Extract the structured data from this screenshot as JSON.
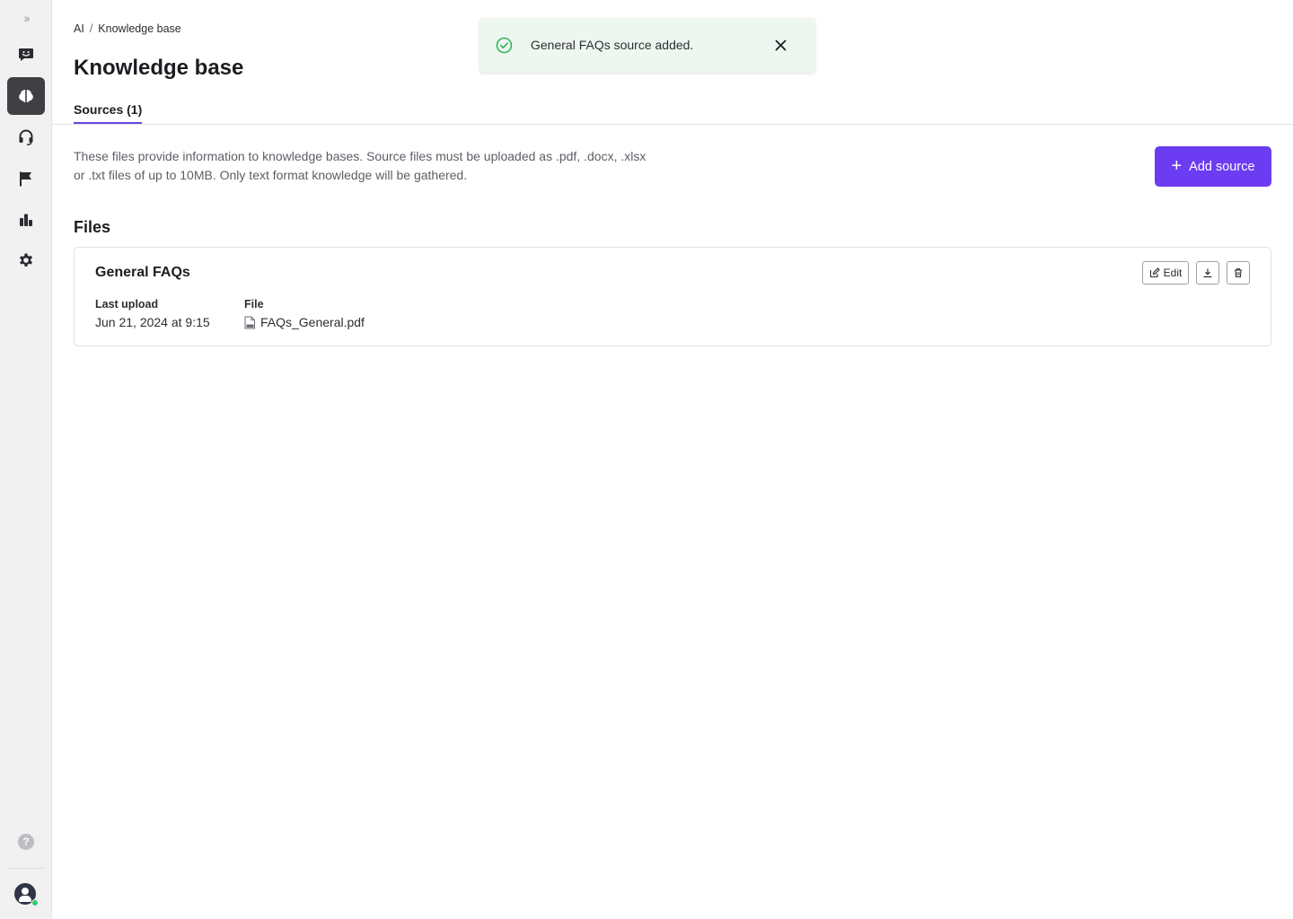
{
  "sidebar": {
    "expand_icon": "double-chevron-right-icon",
    "items": [
      {
        "name": "conversations",
        "icon": "chat-smile-icon",
        "active": false
      },
      {
        "name": "ai",
        "icon": "brain-icon",
        "active": true
      },
      {
        "name": "support",
        "icon": "headset-icon",
        "active": false
      },
      {
        "name": "flags",
        "icon": "flag-icon",
        "active": false
      },
      {
        "name": "reports",
        "icon": "bar-chart-icon",
        "active": false
      },
      {
        "name": "settings",
        "icon": "gear-icon",
        "active": false
      }
    ],
    "help_glyph": "?",
    "help_icon": "help-icon",
    "avatar_icon": "user-avatar-icon"
  },
  "breadcrumb": {
    "parent": "AI",
    "separator": "/",
    "current": "Knowledge base"
  },
  "page": {
    "title": "Knowledge base"
  },
  "tabs": [
    {
      "label": "Sources (1)",
      "active": true
    }
  ],
  "description": "These files provide information to knowledge bases. Source files must be uploaded as .pdf, .docx, .xlsx or .txt files of up to 10MB. Only text format knowledge will be gathered.",
  "add_source": {
    "label": "Add source",
    "plus": "+"
  },
  "files_section": {
    "title": "Files"
  },
  "files": [
    {
      "title": "General FAQs",
      "last_upload_label": "Last upload",
      "last_upload_value": "Jun 21, 2024 at 9:15",
      "file_label": "File",
      "file_name": "FAQs_General.pdf",
      "file_icon": "pdf-file-icon",
      "actions": {
        "edit_label": "Edit",
        "edit_icon": "edit-icon",
        "download_icon": "download-icon",
        "delete_icon": "trash-icon"
      }
    }
  ],
  "toast": {
    "message": "General FAQs source added.",
    "status_icon": "check-circle-icon",
    "close_icon": "close-icon"
  },
  "colors": {
    "accent": "#6c3cf2",
    "tab_underline": "#6a45e6",
    "success": "#2fb45a",
    "toast_bg": "#edf7f0",
    "sidebar_active": "#3f3f44"
  }
}
